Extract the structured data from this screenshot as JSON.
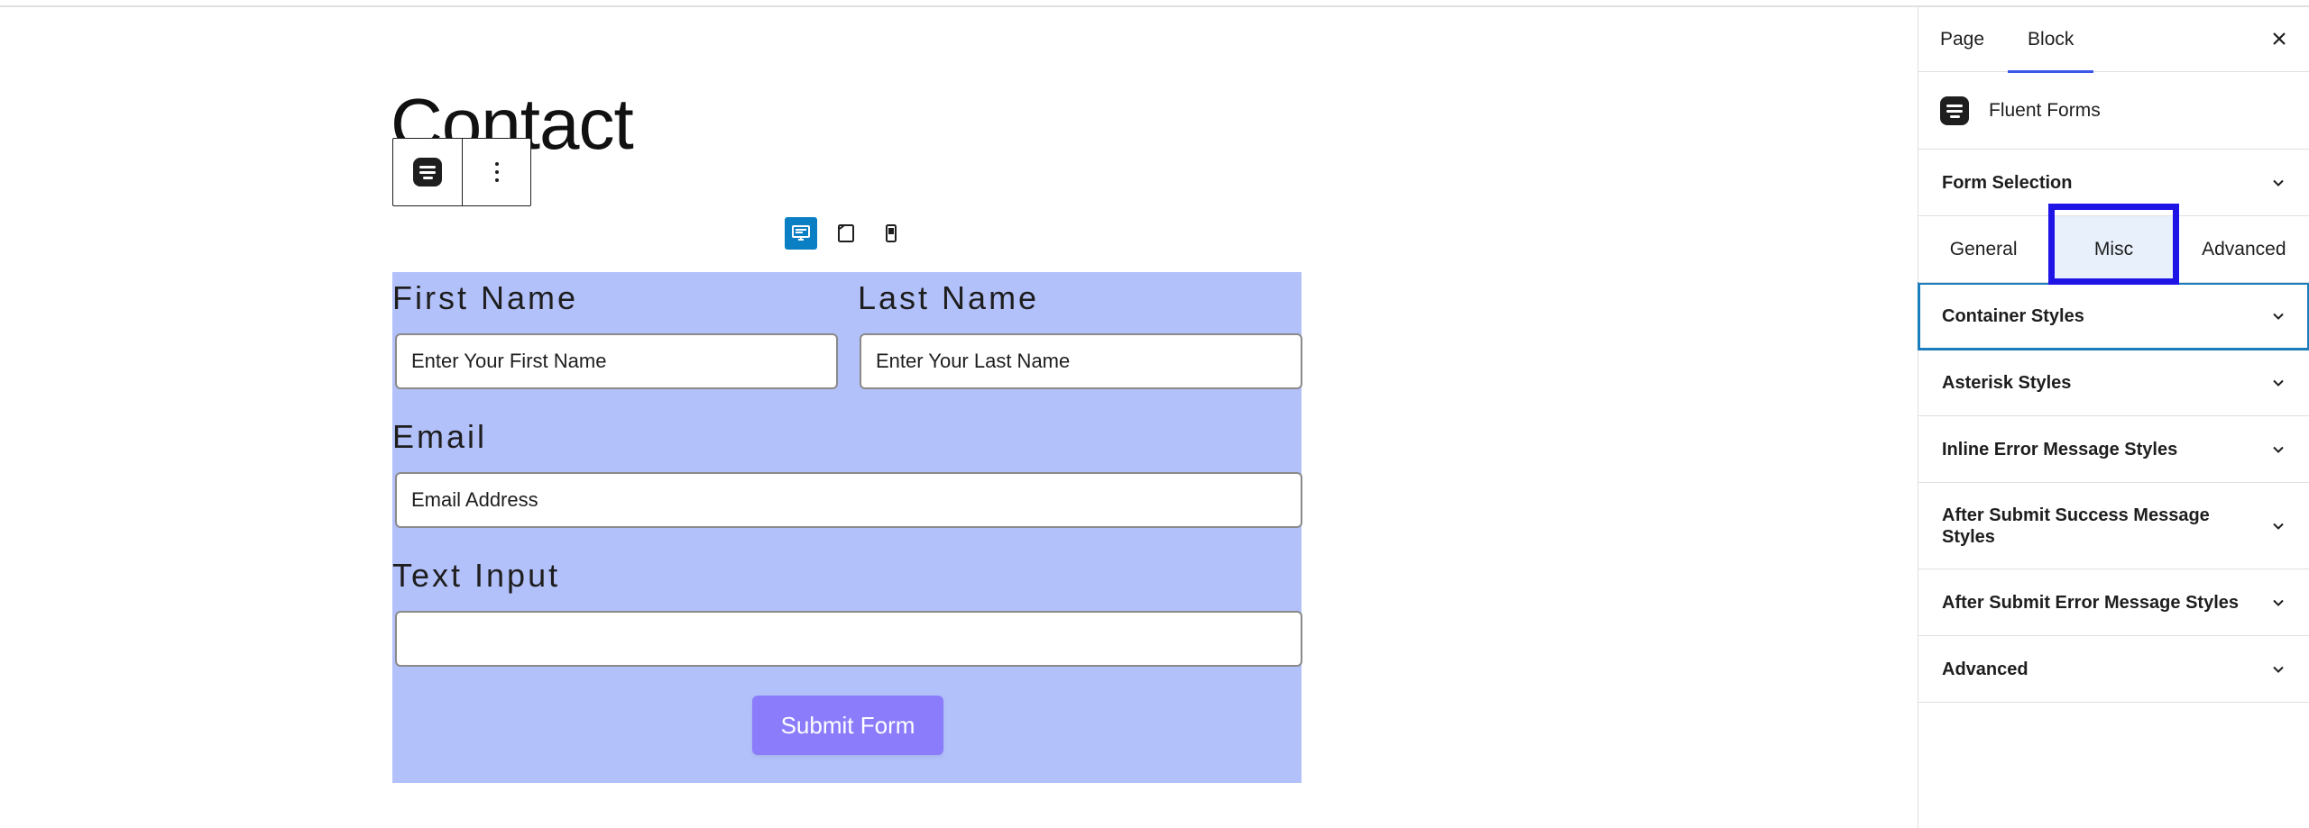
{
  "page": {
    "title": "Contact"
  },
  "block_toolbar": {
    "block_icon": "fluent-forms-icon",
    "options_icon": "more-vertical-icon"
  },
  "device_preview": {
    "options": [
      "desktop",
      "tablet",
      "mobile"
    ],
    "active": "desktop"
  },
  "form": {
    "first_name": {
      "label": "First Name",
      "placeholder": "Enter Your First Name"
    },
    "last_name": {
      "label": "Last Name",
      "placeholder": "Enter Your Last Name"
    },
    "email": {
      "label": "Email",
      "placeholder": "Email Address"
    },
    "text_input": {
      "label": "Text Input",
      "placeholder": ""
    },
    "submit_label": "Submit Form",
    "colors": {
      "background": "#b3c1fb",
      "submit": "#8b7cfb"
    }
  },
  "sidebar": {
    "tabs": [
      {
        "label": "Page",
        "active": false
      },
      {
        "label": "Block",
        "active": true
      }
    ],
    "block_name": "Fluent Forms",
    "form_selection": "Form Selection",
    "subtabs": [
      {
        "label": "General",
        "active": false
      },
      {
        "label": "Misc",
        "active": true
      },
      {
        "label": "Advanced",
        "active": false
      }
    ],
    "sections": [
      "Container Styles",
      "Asterisk Styles",
      "Inline Error Message Styles",
      "After Submit Success Message Styles",
      "After Submit Error Message Styles",
      "Advanced"
    ],
    "accent_color": "#3858e9"
  }
}
